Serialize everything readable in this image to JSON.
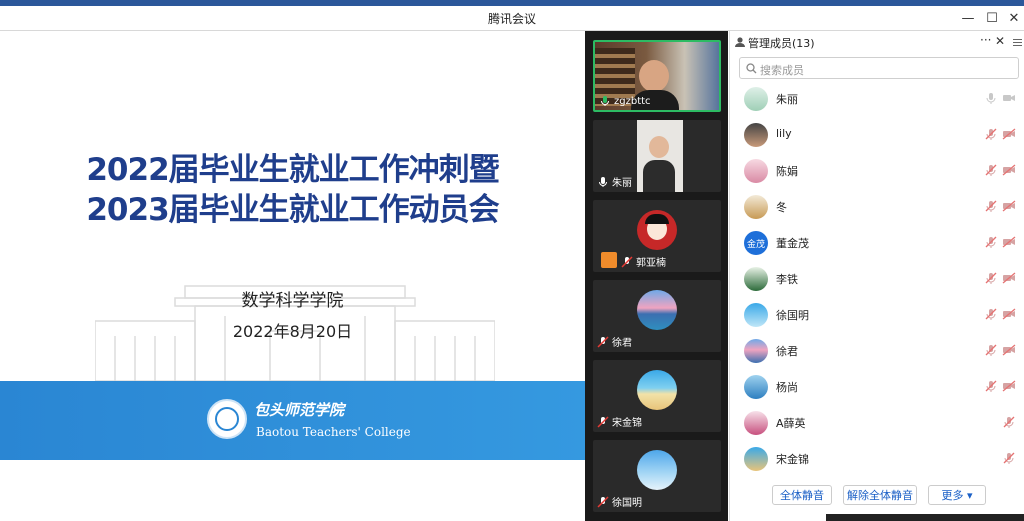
{
  "window": {
    "title": "腾讯会议",
    "btn_min": "—",
    "btn_max": "☐",
    "btn_close": "✕"
  },
  "slide": {
    "title_line1": "2022届毕业生就业工作冲刺暨",
    "title_line2": "2023届毕业生就业工作动员会",
    "school": "数学科学学院",
    "date": "2022年8月20日",
    "college_cn": "包头师范学院",
    "college_en": "Baotou Teachers' College",
    "band_color": "#2a86d3"
  },
  "videos": [
    {
      "name": "zgzbttc",
      "speaking": true
    },
    {
      "name": "朱丽"
    },
    {
      "name": "郭亚楠"
    },
    {
      "name": "徐君"
    },
    {
      "name": "宋金锦"
    },
    {
      "name": "徐国明"
    }
  ],
  "panel": {
    "title": "管理成员(13)",
    "more": "···",
    "close": "✕",
    "search_placeholder": "搜索成员",
    "members": [
      {
        "name": "朱丽",
        "avatar_text": ""
      },
      {
        "name": "lily",
        "avatar_text": ""
      },
      {
        "name": "陈娟",
        "avatar_text": ""
      },
      {
        "name": "冬",
        "avatar_text": ""
      },
      {
        "name": "董金茂",
        "avatar_text": "金茂"
      },
      {
        "name": "李铁",
        "avatar_text": ""
      },
      {
        "name": "徐国明",
        "avatar_text": ""
      },
      {
        "name": "徐君",
        "avatar_text": ""
      },
      {
        "name": "杨尚",
        "avatar_text": ""
      },
      {
        "name": "A薛英",
        "avatar_text": ""
      },
      {
        "name": "宋金锦",
        "avatar_text": ""
      }
    ],
    "buttons": {
      "mute_all": "全体静音",
      "unmute_all": "解除全体静音",
      "more": "更多 ▾"
    }
  }
}
